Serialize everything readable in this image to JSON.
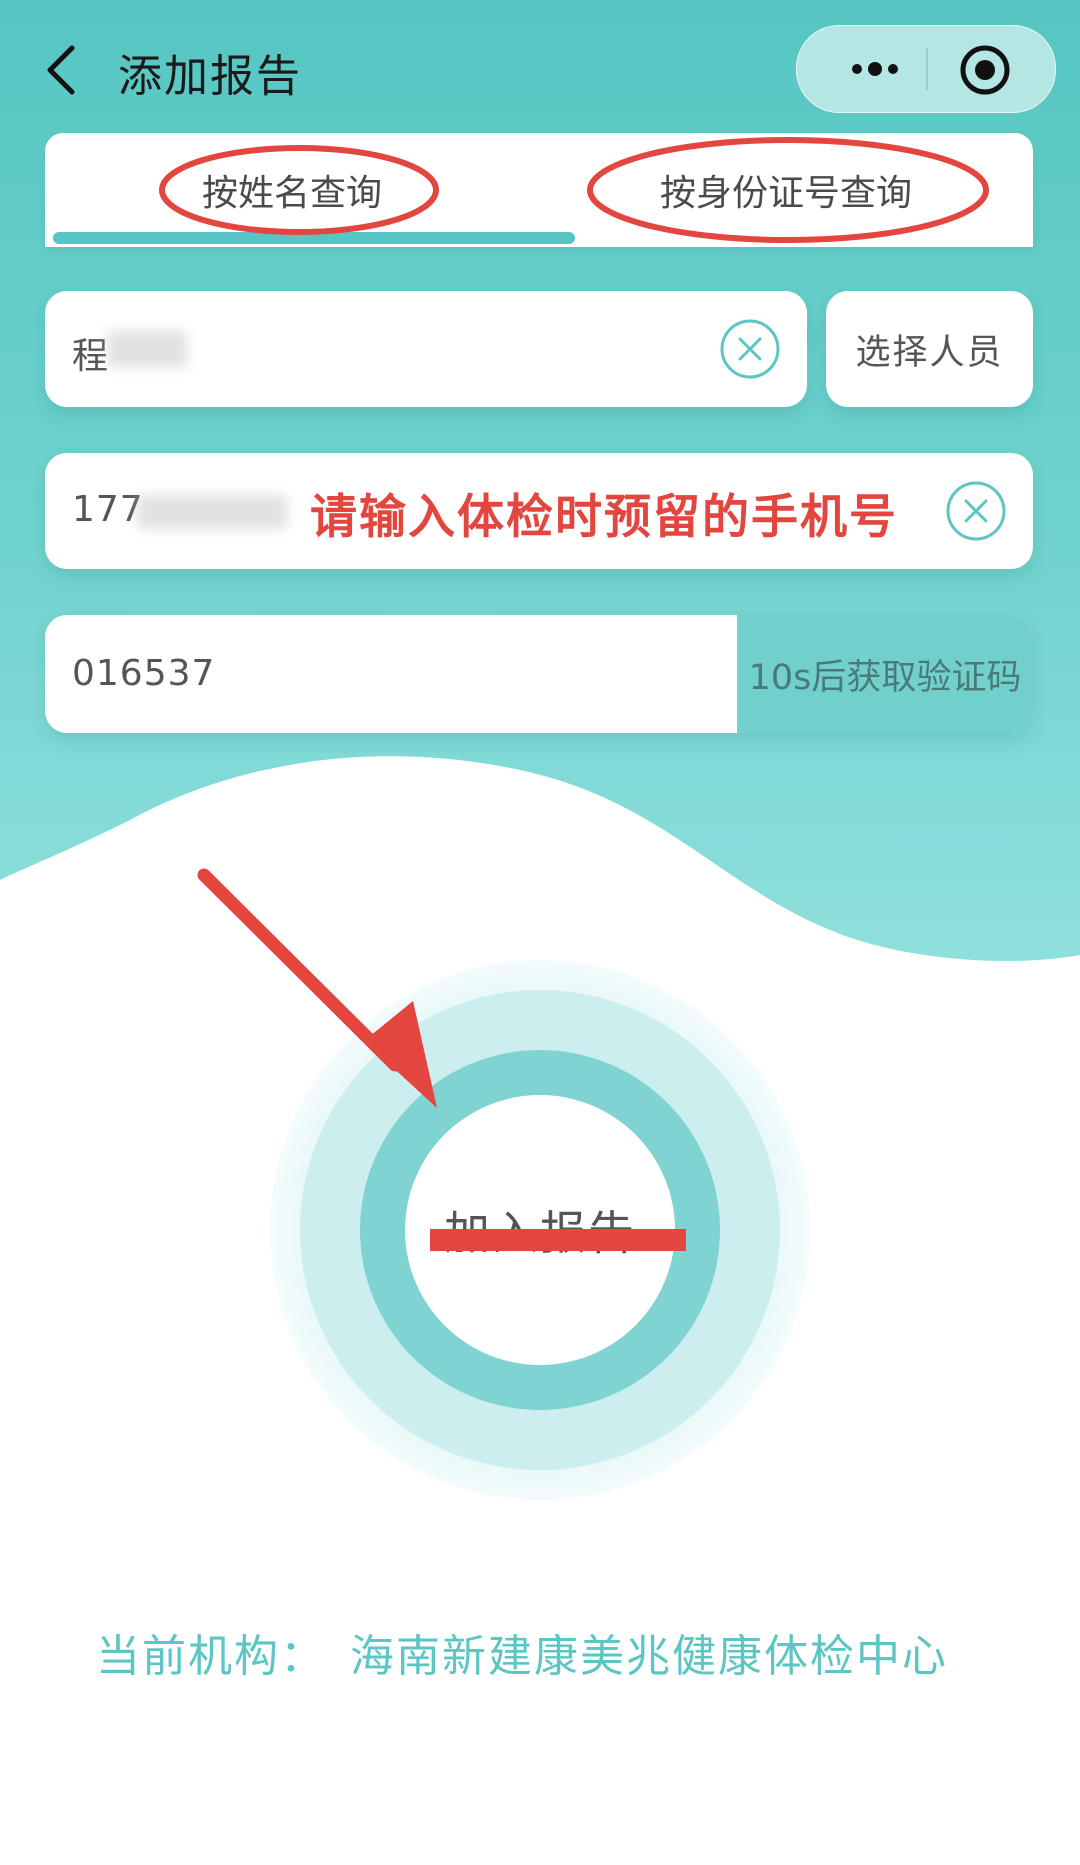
{
  "header": {
    "title": "添加报告",
    "back_icon": "chevron-left-icon",
    "more_icon": "more-dots-icon",
    "close_icon": "target-circle-icon"
  },
  "tabs": [
    {
      "label": "按姓名查询",
      "active": true
    },
    {
      "label": "按身份证号查询",
      "active": false
    }
  ],
  "form": {
    "name_value": "程",
    "select_person_label": "选择人员",
    "phone_value": "177",
    "phone_hint_annotation": "请输入体检时预留的手机号",
    "code_value": "016537",
    "get_code_label": "10s后获取验证码"
  },
  "action": {
    "join_label": "加入报告"
  },
  "footer": {
    "org_label": "当前机构：",
    "org_name": "海南新建康美兆健康体检中心"
  },
  "colors": {
    "accent": "#57c5c5",
    "annotation_red": "#e2463e",
    "org_text": "#5cc6c4"
  }
}
